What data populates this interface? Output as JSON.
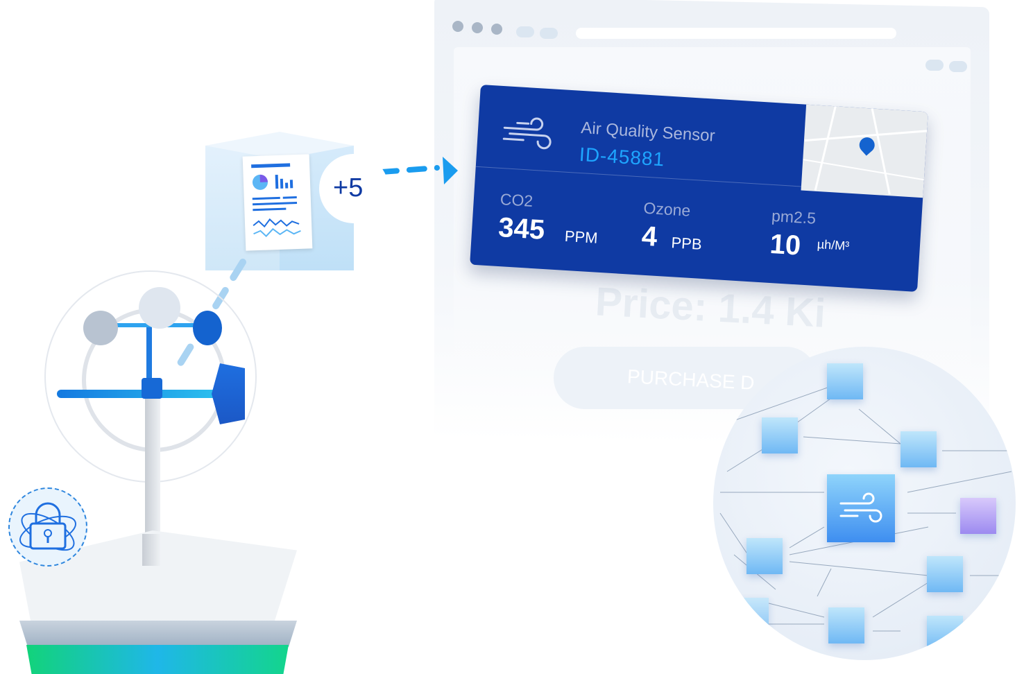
{
  "sensor_card": {
    "title": "Air Quality Sensor",
    "id": "ID-45881",
    "metrics": [
      {
        "label": "CO2",
        "value": "345",
        "unit": "PPM"
      },
      {
        "label": "Ozone",
        "value": "4",
        "unit": "PPB"
      },
      {
        "label": "pm2.5",
        "value": "10",
        "unit": "µh/M³"
      }
    ]
  },
  "listing": {
    "price": "Price: 1.4 Ki",
    "purchase_label": "PURCHASE D"
  },
  "bubble_text": "+5",
  "icons": [
    "wind-icon",
    "map-pin-icon",
    "document-icon",
    "lock-icon",
    "weather-station-icon",
    "network-node-icon"
  ],
  "colors": {
    "card_bg": "#0f3aa3",
    "accent": "#1ea5ff",
    "ground": "#12d37a"
  }
}
